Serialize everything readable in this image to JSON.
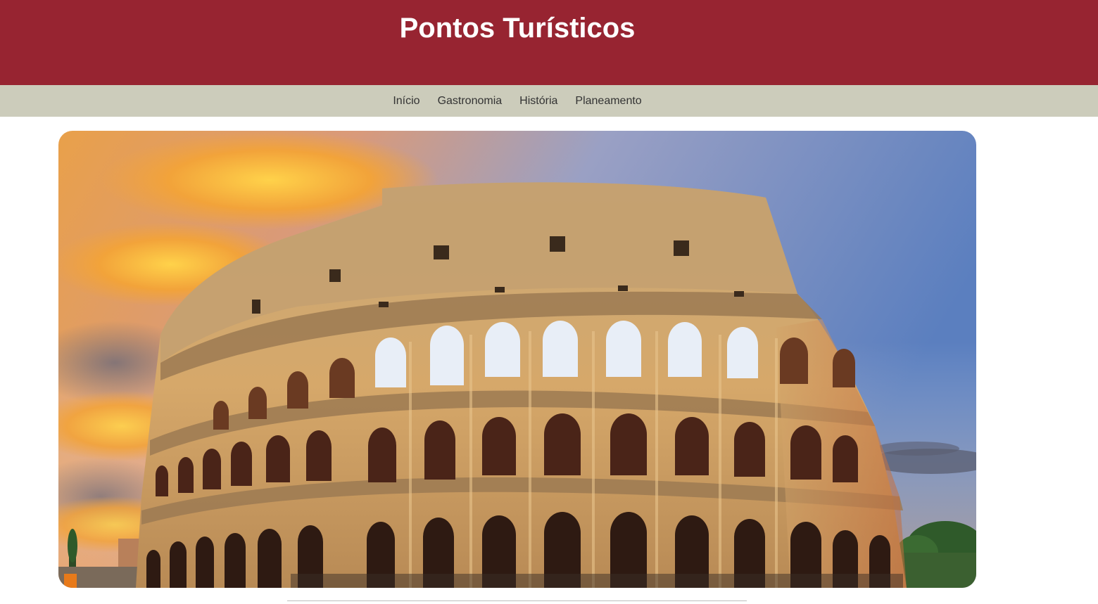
{
  "header": {
    "title": "Pontos Turísticos",
    "background_color": "#972431"
  },
  "nav": {
    "background_color": "#ccccbb",
    "items": [
      {
        "label": "Início"
      },
      {
        "label": "Gastronomia"
      },
      {
        "label": "História"
      },
      {
        "label": "Planeamento"
      }
    ]
  },
  "hero": {
    "image": "colosseum-photo"
  }
}
